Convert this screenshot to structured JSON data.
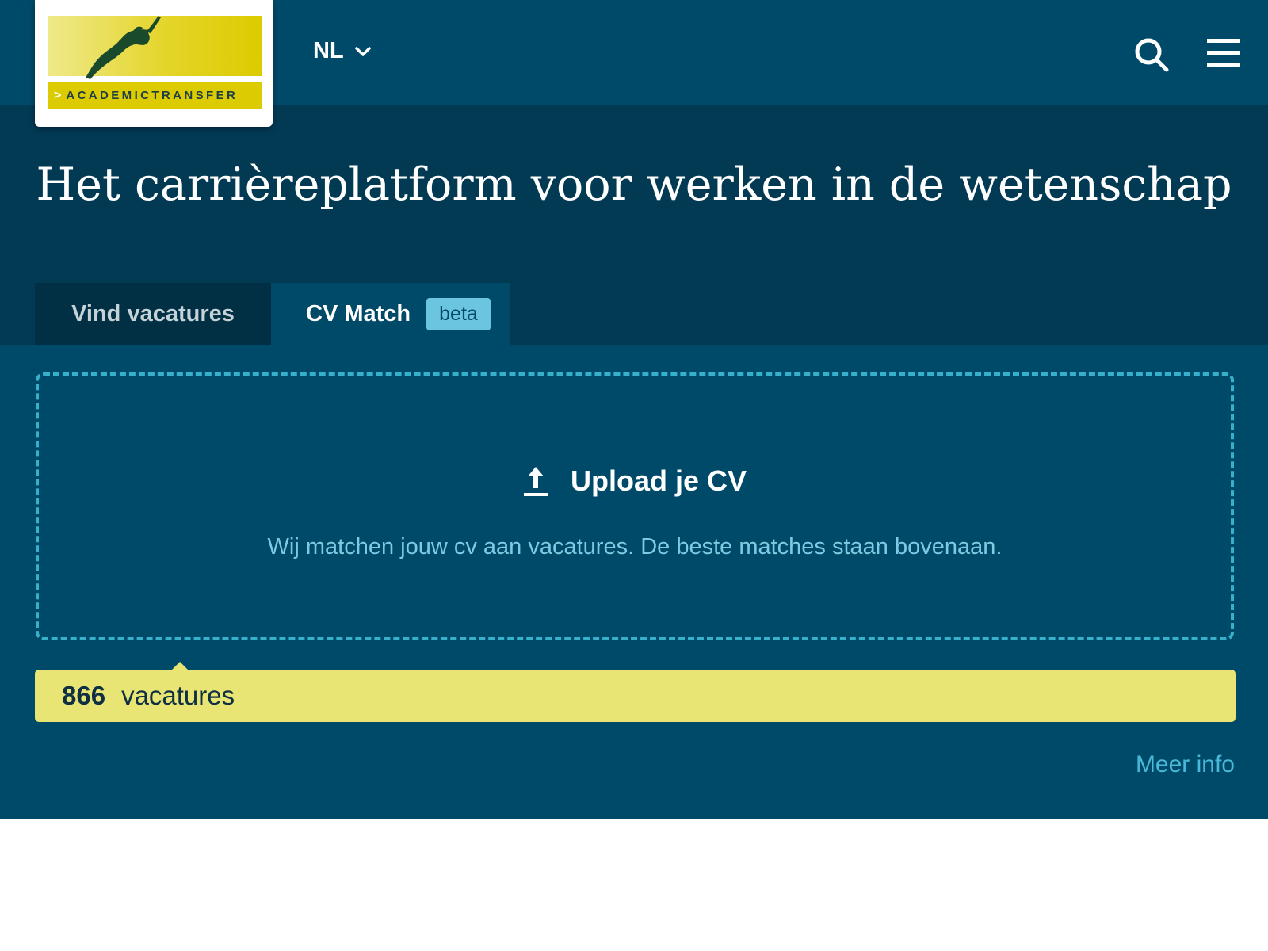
{
  "header": {
    "logo_text": "ACADEMICTRANSFER",
    "language": "NL"
  },
  "hero": {
    "title": "Het carrièreplatform voor werken in de wetenschap"
  },
  "tabs": [
    {
      "label": "Vind vacatures",
      "active": false
    },
    {
      "label": "CV Match",
      "badge": "beta",
      "active": true
    }
  ],
  "upload": {
    "label": "Upload je CV",
    "description": "Wij matchen jouw cv aan vacatures. De beste matches staan bovenaan."
  },
  "results": {
    "count": "866",
    "label": "vacatures"
  },
  "footer_link": "Meer info",
  "colors": {
    "header_bg": "#004a69",
    "hero_bg": "#023a54",
    "accent_yellow": "#e8e574",
    "accent_cyan": "#37b0cc",
    "logo_yellow": "#dccb00"
  },
  "icons": [
    "diver-logo-icon",
    "chevron-down-icon",
    "search-icon",
    "hamburger-menu-icon",
    "upload-icon"
  ]
}
